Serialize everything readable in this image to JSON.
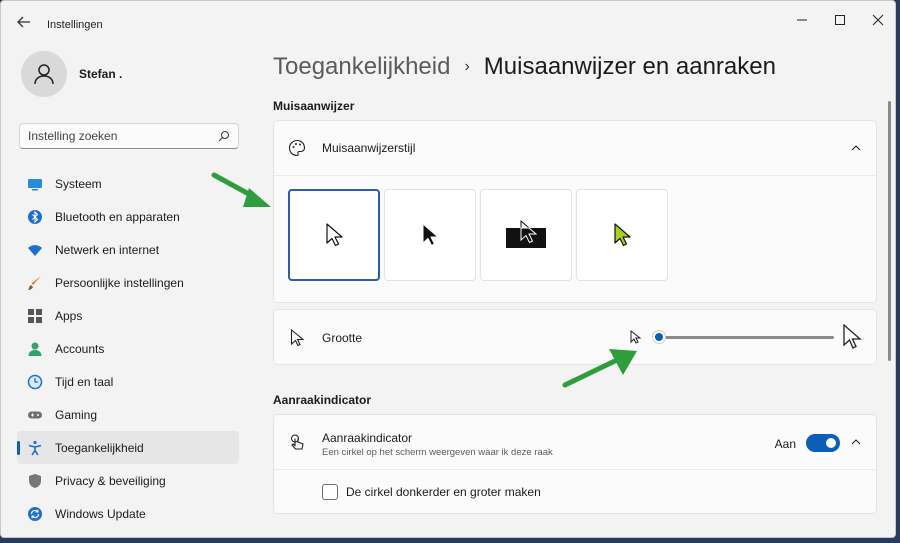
{
  "window": {
    "title": "Instellingen",
    "controls": [
      "minimize-icon",
      "maximize-icon",
      "close-icon"
    ]
  },
  "user": {
    "name": "Stefan ."
  },
  "search": {
    "placeholder": "Instelling zoeken"
  },
  "sidebar": {
    "items": [
      {
        "label": "Systeem",
        "icon": "monitor-icon"
      },
      {
        "label": "Bluetooth en apparaten",
        "icon": "bluetooth-icon"
      },
      {
        "label": "Netwerk en internet",
        "icon": "wifi-icon"
      },
      {
        "label": "Persoonlijke instellingen",
        "icon": "brush-icon"
      },
      {
        "label": "Apps",
        "icon": "apps-icon"
      },
      {
        "label": "Accounts",
        "icon": "person-icon"
      },
      {
        "label": "Tijd en taal",
        "icon": "globe-clock-icon"
      },
      {
        "label": "Gaming",
        "icon": "gamepad-icon"
      },
      {
        "label": "Toegankelijkheid",
        "icon": "accessibility-icon",
        "active": true
      },
      {
        "label": "Privacy & beveiliging",
        "icon": "shield-icon"
      },
      {
        "label": "Windows Update",
        "icon": "update-icon"
      }
    ]
  },
  "breadcrumb": {
    "parent": "Toegankelijkheid",
    "separator": "›",
    "current": "Muisaanwijzer en aanraken"
  },
  "sections": {
    "mouse": {
      "heading": "Muisaanwijzer",
      "style_label": "Muisaanwijzerstijl",
      "style_options": [
        "white-cursor",
        "black-cursor",
        "inverted-cursor",
        "custom-cursor"
      ],
      "selected_style": 0,
      "custom_color": "#a8d11e",
      "size_label": "Grootte",
      "size_value": 0.0
    },
    "touch": {
      "heading": "Aanraakindicator",
      "title": "Aanraakindicator",
      "description": "Een cirkel op het scherm weergeven waar ik deze raak",
      "toggle_label": "Aan",
      "toggle_on": true,
      "checkbox_label": "De cirkel donkerder en groter maken",
      "checkbox_checked": false
    }
  },
  "colors": {
    "accent": "#0a5fb8",
    "annotation_arrow": "#2e9e3c"
  }
}
